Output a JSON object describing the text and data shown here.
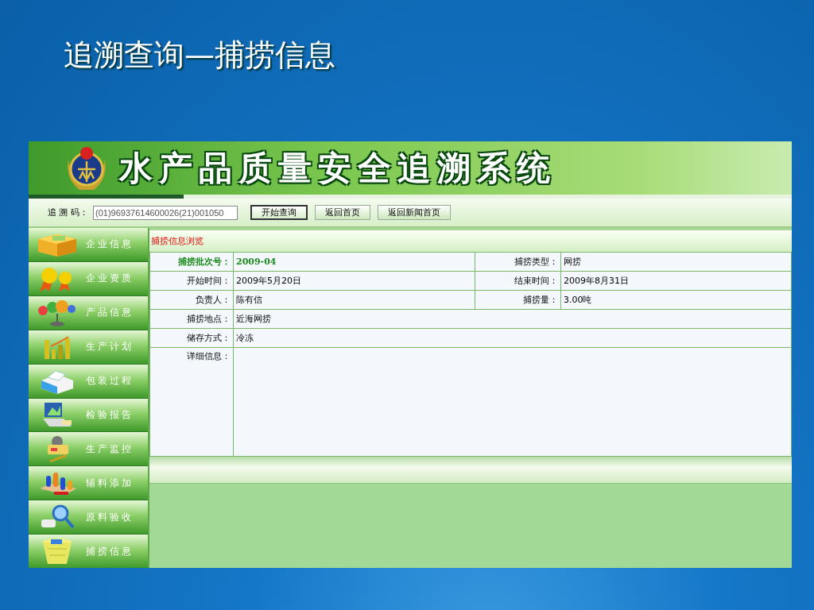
{
  "slide_title": "追溯查询—捕捞信息",
  "app": {
    "title": "水产品质量安全追溯系统",
    "search": {
      "label": "追 溯 码：",
      "value": "(01)96937614600026(21)001050"
    },
    "buttons": [
      {
        "label": "开始查询",
        "kind": "primary"
      },
      {
        "label": "返回首页",
        "kind": "plain"
      },
      {
        "label": "返回新闻首页",
        "kind": "plain"
      }
    ],
    "sidebar": {
      "items": [
        {
          "label": "企业信息"
        },
        {
          "label": "企业资质"
        },
        {
          "label": "产品信息"
        },
        {
          "label": "生产计划"
        },
        {
          "label": "包装过程"
        },
        {
          "label": "检验报告"
        },
        {
          "label": "生产监控"
        },
        {
          "label": "辅料添加"
        },
        {
          "label": "原料验收"
        },
        {
          "label": "捕捞信息"
        }
      ]
    },
    "panel": {
      "title": "捕捞信息浏览",
      "rows": [
        {
          "kind": "pair",
          "emphasis": true,
          "cells": [
            {
              "label": "捕捞批次号：",
              "value": "2009-04"
            },
            {
              "label": "捕捞类型：",
              "value": "网捞"
            }
          ]
        },
        {
          "kind": "pair",
          "emphasis": false,
          "cells": [
            {
              "label": "开始时间：",
              "value": "2009年5月20日"
            },
            {
              "label": "结束时间：",
              "value": "2009年8月31日"
            }
          ]
        },
        {
          "kind": "pair",
          "emphasis": false,
          "cells": [
            {
              "label": "负责人：",
              "value": "陈有信"
            },
            {
              "label": "捕捞量：",
              "value": "3.00吨"
            }
          ]
        },
        {
          "kind": "single",
          "emphasis": false,
          "cells": [
            {
              "label": "捕捞地点：",
              "value": "近海网捞"
            }
          ]
        },
        {
          "kind": "single",
          "emphasis": false,
          "cells": [
            {
              "label": "储存方式：",
              "value": "冷冻"
            }
          ]
        },
        {
          "kind": "detail",
          "emphasis": false,
          "cells": [
            {
              "label": "详细信息："
            }
          ]
        }
      ]
    }
  }
}
